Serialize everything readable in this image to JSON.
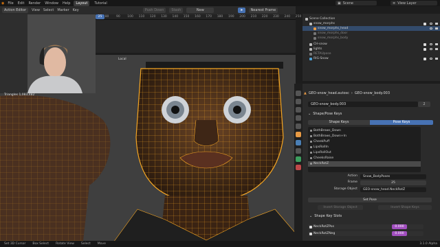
{
  "topbar": {
    "menus": [
      "File",
      "Edit",
      "Render",
      "Window",
      "Help"
    ],
    "tabs": [
      "Layout",
      "Tutorial"
    ],
    "active_tab": "Layout",
    "scene_label": "Scene",
    "view_layer_label": "View Layer"
  },
  "action_editor": {
    "mode": "Action Editor",
    "menus": [
      "View",
      "Select",
      "Marker",
      "Key"
    ],
    "push_down": "Push Down",
    "stash": "Stash",
    "new_button": "New",
    "snapping": "Nearest Frame",
    "ruler_numbers": [
      "-10",
      "0",
      "10",
      "20",
      "30",
      "40",
      "50",
      "60",
      "70",
      "80",
      "90",
      "100",
      "110",
      "120",
      "130",
      "140",
      "150",
      "160",
      "170",
      "180",
      "190",
      "200",
      "210",
      "220",
      "230",
      "240",
      "250"
    ],
    "current_frame": "25"
  },
  "viewport": {
    "orientation": "Local",
    "transform_text": "Triangles   1,083,482",
    "colors": {
      "background": "#3f3f3f",
      "wireframe": "#f5a623",
      "skin": "#3a2313"
    }
  },
  "outliner": {
    "rows": [
      {
        "label": "Scene Collection",
        "indent": 0,
        "selected": false
      },
      {
        "label": "snow_morphs",
        "indent": 1,
        "selected": false
      },
      {
        "label": "snow_morphs_head",
        "indent": 2,
        "selected": true
      },
      {
        "label": "snow_morphs_door",
        "indent": 2,
        "selected": false
      },
      {
        "label": "snow_morphs_body",
        "indent": 2,
        "selected": false
      },
      {
        "label": "CH-snow",
        "indent": 1,
        "selected": false
      },
      {
        "label": "lights",
        "indent": 1,
        "selected": false
      },
      {
        "label": "RETAUpose",
        "indent": 1,
        "selected": false
      },
      {
        "label": "RIG-Snow",
        "indent": 1,
        "selected": false
      }
    ]
  },
  "properties": {
    "breadcrumb_object": "GEO-snow_head.autosc",
    "breadcrumb_mesh": "GEO-snow_body.003",
    "mesh_name": "GEO-snow_body.003",
    "mesh_users": "2",
    "panel_title": "Shape/Pose Keys",
    "tab_shape": "Shape Keys",
    "tab_pose": "Pose Keys",
    "pose_keys": [
      "BothBrows_Down",
      "BothBrows_Down+In",
      "CheekPuff",
      "LipsRollIn",
      "LipsRollOut",
      "CheeksRaise",
      "NeckRotZ"
    ],
    "selected_key": "NeckRotZ",
    "action_label": "Action",
    "action_value": "Snow_BodyPoses",
    "frame_label": "Frame",
    "frame_value": "25",
    "storage_label": "Storage Object",
    "storage_value": "GEO-snow_head.NeckRotZ",
    "set_pose": "Set Pose",
    "invert_storage": "Invert Storage Object",
    "invert_shape": "Invert Shape Keys",
    "slots_title": "Shape Key Slots",
    "slots": [
      {
        "name": "NeckRotZPos",
        "value": "0.000"
      },
      {
        "name": "NeckRotZNeg",
        "value": "0.000"
      }
    ],
    "accent": "#4772b3",
    "slot_value_color": "#a24fbf"
  },
  "statusbar": {
    "items": [
      "Set 3D Cursor",
      "Box Select",
      "Rotate View",
      "Select",
      "Move"
    ],
    "version": "3.1.0 Alpha"
  }
}
